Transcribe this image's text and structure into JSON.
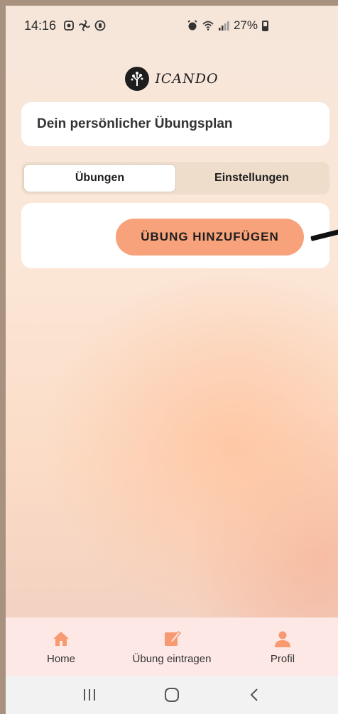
{
  "status_bar": {
    "time": "14:16",
    "battery": "27%"
  },
  "app": {
    "logo_text": "ICANDO"
  },
  "title_card": {
    "title": "Dein persönlicher Übungsplan"
  },
  "tabs": [
    {
      "label": "Übungen",
      "active": true
    },
    {
      "label": "Einstellungen",
      "active": false
    }
  ],
  "panel": {
    "add_button_label": "ÜBUNG HINZUFÜGEN"
  },
  "bottom_nav": [
    {
      "label": "Home",
      "icon": "home-icon"
    },
    {
      "label": "Übung eintragen",
      "icon": "edit-icon"
    },
    {
      "label": "Profil",
      "icon": "profile-icon"
    }
  ],
  "colors": {
    "accent": "#f7a27a",
    "nav_icon": "#f79a72",
    "nav_background": "#fde8e5"
  }
}
